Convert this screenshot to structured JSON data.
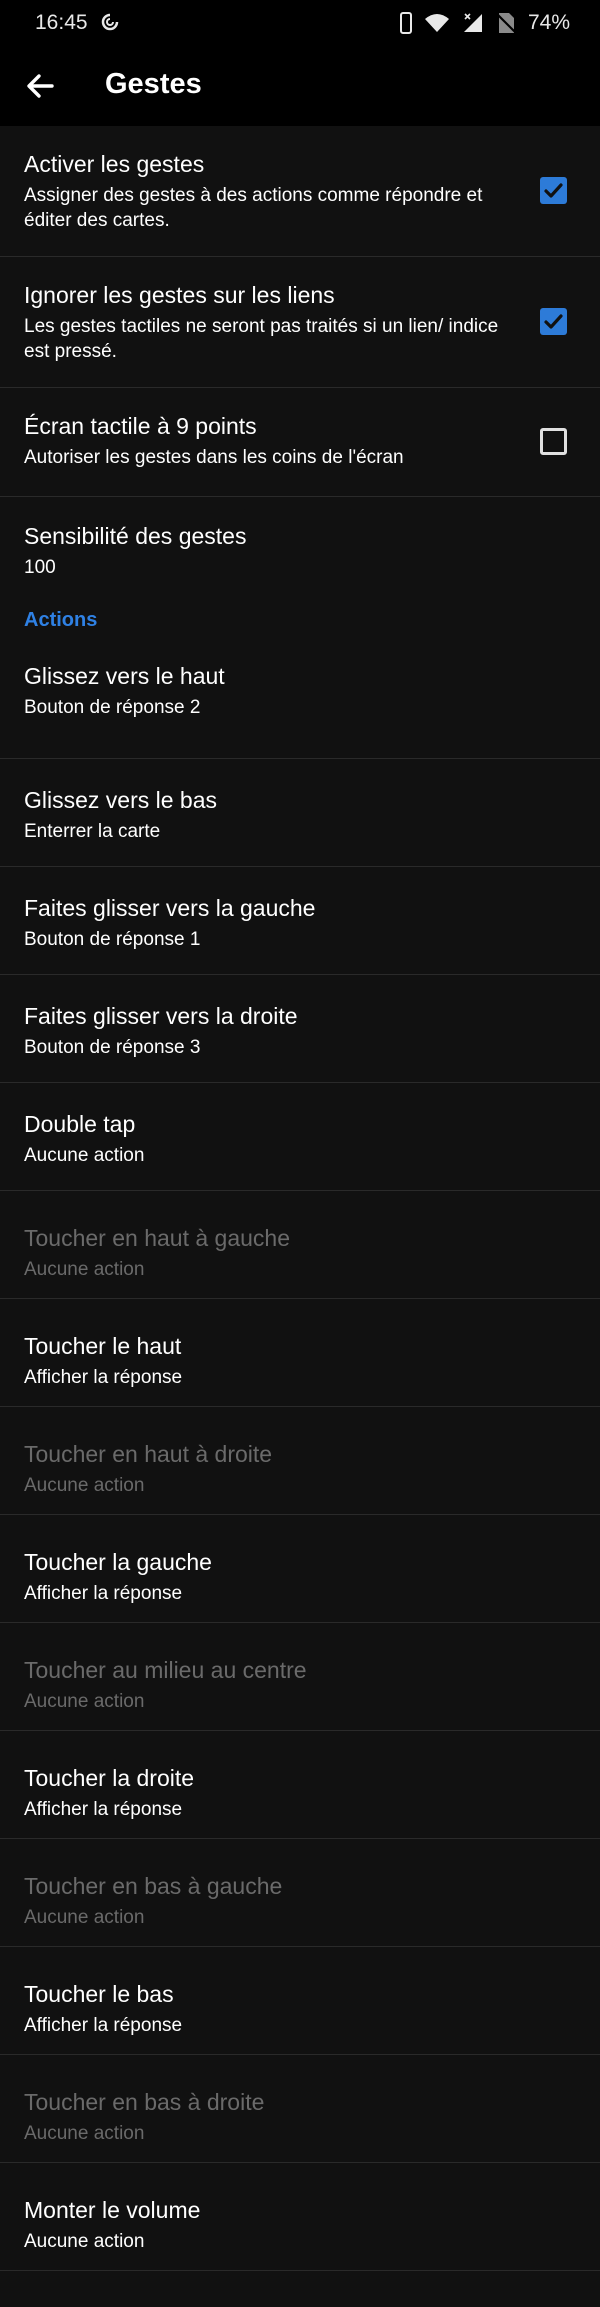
{
  "status": {
    "time": "16:45",
    "battery": "74%",
    "icons": [
      "sync-icon",
      "phone-icon",
      "wifi-icon",
      "signal-icon",
      "no-sim-icon"
    ]
  },
  "appbar": {
    "title": "Gestes",
    "back_icon": "arrow-left-icon"
  },
  "toggles": [
    {
      "title": "Activer les gestes",
      "subtitle": "Assigner des gestes à des actions comme répondre et éditer des cartes.",
      "checked": true
    },
    {
      "title": "Ignorer les gestes sur les liens",
      "subtitle": "Les gestes tactiles ne seront pas traités si un lien/ indice est pressé.",
      "checked": true
    },
    {
      "title": "Écran tactile à 9 points",
      "subtitle": "Autoriser les gestes dans les coins de l'écran",
      "checked": false
    }
  ],
  "sensitivity": {
    "title": "Sensibilité des gestes",
    "value": "100"
  },
  "actions_header": "Actions",
  "actions": [
    {
      "title": "Glissez vers le haut",
      "value": "Bouton de réponse 2",
      "enabled": true
    },
    {
      "title": "Glissez vers le bas",
      "value": "Enterrer la carte",
      "enabled": true
    },
    {
      "title": "Faites glisser vers la gauche",
      "value": "Bouton de réponse 1",
      "enabled": true
    },
    {
      "title": "Faites glisser vers la droite",
      "value": "Bouton de réponse 3",
      "enabled": true
    },
    {
      "title": "Double tap",
      "value": "Aucune action",
      "enabled": true
    },
    {
      "title": "Toucher en haut à gauche",
      "value": "Aucune action",
      "enabled": false
    },
    {
      "title": "Toucher le haut",
      "value": "Afficher la réponse",
      "enabled": true
    },
    {
      "title": "Toucher en haut à droite",
      "value": "Aucune action",
      "enabled": false
    },
    {
      "title": "Toucher la gauche",
      "value": "Afficher la réponse",
      "enabled": true
    },
    {
      "title": "Toucher au milieu au centre",
      "value": "Aucune action",
      "enabled": false
    },
    {
      "title": "Toucher la droite",
      "value": "Afficher la réponse",
      "enabled": true
    },
    {
      "title": "Toucher en bas à gauche",
      "value": "Aucune action",
      "enabled": false
    },
    {
      "title": "Toucher le bas",
      "value": "Afficher la réponse",
      "enabled": true
    },
    {
      "title": "Toucher en bas à droite",
      "value": "Aucune action",
      "enabled": false
    },
    {
      "title": "Monter le volume",
      "value": "Aucune action",
      "enabled": true
    }
  ],
  "colors": {
    "background": "#111111",
    "bar": "#000000",
    "accent": "#2f81e4",
    "checkbox": "#2d7bd8",
    "disabled_text": "#6a6a6a",
    "divider": "#2a2a2a"
  }
}
